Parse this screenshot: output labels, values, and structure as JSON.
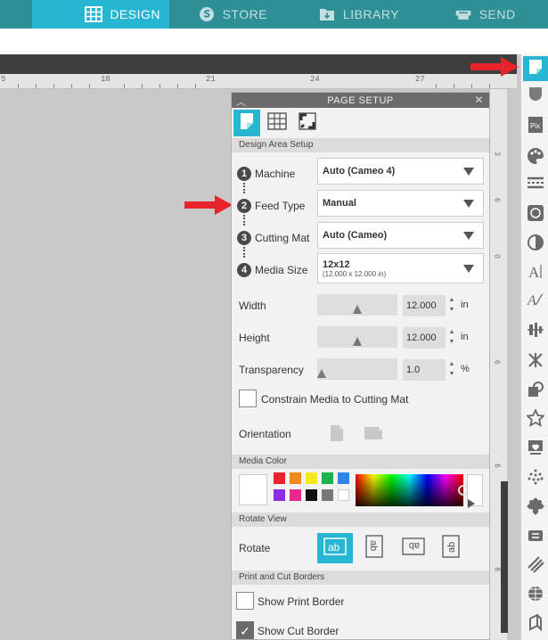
{
  "nav": {
    "tabs": [
      {
        "label": "DESIGN",
        "icon": "grid-icon",
        "active": true
      },
      {
        "label": "STORE",
        "icon": "store-s-icon",
        "active": false
      },
      {
        "label": "LIBRARY",
        "icon": "library-icon",
        "active": false
      },
      {
        "label": "SEND",
        "icon": "cutter-icon",
        "active": false
      }
    ]
  },
  "ruler": {
    "top_numbers": [
      "5",
      "18",
      "21",
      "24",
      "27"
    ],
    "side_numbers": [
      "3",
      "6",
      "9",
      "0",
      "6",
      "6",
      "8"
    ]
  },
  "panel": {
    "title": "PAGE SETUP",
    "sections": {
      "design_area": "Design Area Setup",
      "media_color": "Media Color",
      "rotate_view": "Rotate View",
      "print_cut": "Print and Cut Borders"
    },
    "steps": [
      {
        "num": "1",
        "label": "Machine",
        "value": "Auto (Cameo 4)",
        "sub": ""
      },
      {
        "num": "2",
        "label": "Feed Type",
        "value": "Manual",
        "sub": ""
      },
      {
        "num": "3",
        "label": "Cutting Mat",
        "value": "Auto (Cameo)",
        "sub": ""
      },
      {
        "num": "4",
        "label": "Media Size",
        "value": "12x12",
        "sub": "(12.000 x 12.000 in)"
      }
    ],
    "width": {
      "label": "Width",
      "value": "12.000",
      "unit": "in",
      "level": 0.5
    },
    "height": {
      "label": "Height",
      "value": "12.000",
      "unit": "in",
      "level": 0.5
    },
    "transparency": {
      "label": "Transparency",
      "value": "1.0",
      "unit": "%",
      "level": 0.0
    },
    "constrain_label": "Constrain Media to Cutting Mat",
    "constrain_checked": false,
    "orientation_label": "Orientation",
    "rotate_label": "Rotate",
    "rotate_icons": [
      "ab",
      "ab",
      "ab",
      "ab"
    ],
    "show_print_border": "Show Print Border",
    "show_print_checked": false,
    "show_cut_border": "Show Cut Border",
    "show_cut_checked": true
  },
  "colors": {
    "accent": "#27b6d2",
    "nav_bg": "#2e8f97",
    "swatches": [
      "#e8232b",
      "#f08a1c",
      "#f6e81f",
      "#1fb14a",
      "#2f86e8",
      "#8b2be2",
      "#e8288f",
      "#111111",
      "#777777",
      "#ffffff"
    ]
  }
}
